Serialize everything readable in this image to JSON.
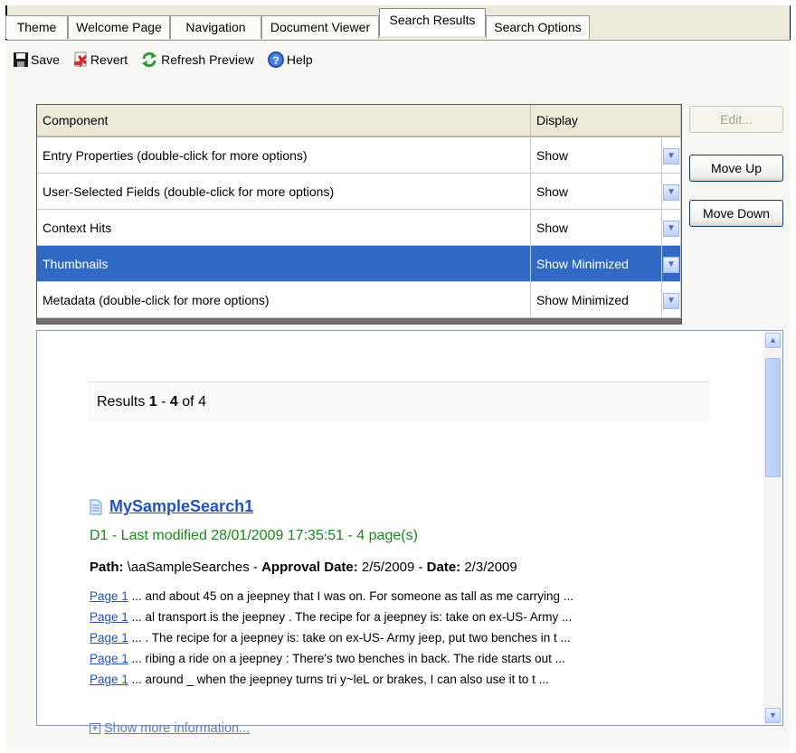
{
  "tabs": [
    {
      "label": "Theme",
      "active": false
    },
    {
      "label": "Welcome Page",
      "active": false
    },
    {
      "label": "Navigation",
      "active": false
    },
    {
      "label": "Document Viewer",
      "active": false
    },
    {
      "label": "Search Results",
      "active": true
    },
    {
      "label": "Search Options",
      "active": false
    }
  ],
  "toolbar": {
    "save_label": "Save",
    "revert_label": "Revert",
    "refresh_label": "Refresh Preview",
    "help_label": "Help"
  },
  "grid": {
    "col_component": "Component",
    "col_display": "Display",
    "rows": [
      {
        "component": "Entry Properties  (double-click for more options)",
        "display": "Show",
        "selected": false
      },
      {
        "component": "User-Selected Fields  (double-click for more options)",
        "display": "Show",
        "selected": false
      },
      {
        "component": "Context Hits",
        "display": "Show",
        "selected": false
      },
      {
        "component": "Thumbnails",
        "display": "Show Minimized",
        "selected": true
      },
      {
        "component": "Metadata  (double-click for more options)",
        "display": "Show Minimized",
        "selected": false
      }
    ]
  },
  "buttons": {
    "edit": "Edit...",
    "move_up": "Move Up",
    "move_down": "Move Down"
  },
  "preview": {
    "results_prefix": "Results ",
    "results_from": "1",
    "results_dash": " - ",
    "results_to": "4",
    "results_suffix": " of 4",
    "hit_title": "MySampleSearch1",
    "hit_meta": "D1 - Last modified 28/01/2009 17:35:51 - 4 page(s)",
    "path_label": "Path:",
    "path_value": " \\aaSampleSearches - ",
    "approval_label": "Approval Date:",
    "approval_value": " 2/5/2009 - ",
    "date_label": "Date:",
    "date_value": " 2/3/2009",
    "snippets": [
      {
        "link": "Page 1",
        "text": " ... and about 45 on a jeepney that I was on. For someone as tall as me carrying ..."
      },
      {
        "link": "Page 1",
        "text": " ... al transport is the jeepney . The recipe for a jeepney is: take on ex-US- Army ..."
      },
      {
        "link": "Page 1",
        "text": " ... . The recipe for a jeepney is: take on ex-US- Army jeep, put two benches in t ..."
      },
      {
        "link": "Page 1",
        "text": " ... ribing a ride on a jeepney : There's two benches in back. The ride starts out ..."
      },
      {
        "link": "Page 1",
        "text": " ... around _ when the jeepney turns tri y~leL or brakes, I can also use it to t ..."
      }
    ],
    "show_more": "Show more information..."
  },
  "colors": {
    "selection": "#316ac5",
    "link": "#2352b8",
    "meta_green": "#178a17",
    "panel_bg": "#ece9d8"
  }
}
